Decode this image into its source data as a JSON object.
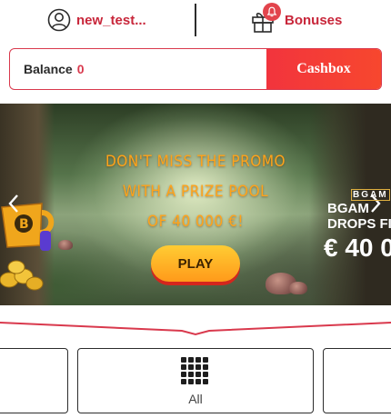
{
  "header": {
    "username": "new_test...",
    "user_icon": "user-circle-icon",
    "bonuses_label": "Bonuses",
    "bonuses_icon": "gift-icon",
    "badge_icon": "bell-icon"
  },
  "balance": {
    "label": "Balance",
    "value": "0",
    "cashbox_label": "Cashbox"
  },
  "banner": {
    "promo_lines": [
      "DON'T MISS THE PROMO",
      "WITH A PRIZE POOL",
      "OF 40 000 €!"
    ],
    "play_label": "PLAY",
    "next_promo": {
      "brand": "BGAM",
      "line1": "BGAM",
      "line2": "DROPS FI",
      "amount": "€ 40 0"
    }
  },
  "categories": {
    "active_label": "All",
    "active_icon": "grid-icon"
  },
  "colors": {
    "accent": "#c8263a",
    "cashbox": "#f2343d",
    "promo_text": "#ffa31a",
    "play_button": "#ffb52a"
  }
}
